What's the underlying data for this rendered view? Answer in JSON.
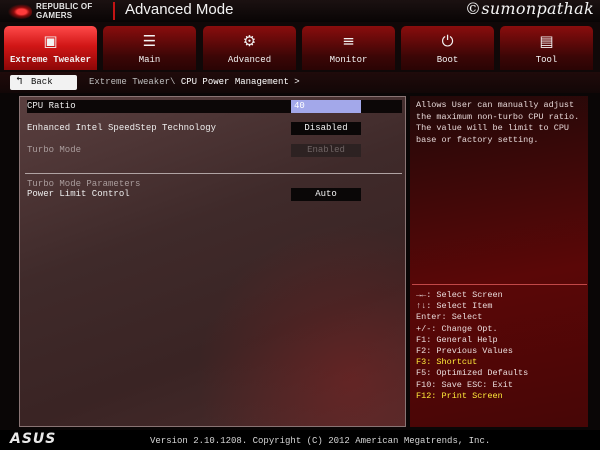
{
  "header": {
    "logo_line1": "REPUBLIC OF",
    "logo_line2": "GAMERS",
    "title": "Advanced Mode",
    "watermark": "©sumonpathak"
  },
  "tabs": [
    {
      "label": "Extreme Tweaker",
      "icon": "cpu-chip-icon",
      "glyph": "▣",
      "active": true
    },
    {
      "label": "Main",
      "icon": "list-icon",
      "glyph": "☰",
      "active": false
    },
    {
      "label": "Advanced",
      "icon": "advanced-settings-icon",
      "glyph": "⚙",
      "active": false
    },
    {
      "label": "Monitor",
      "icon": "monitor-icon",
      "glyph": "≡",
      "active": false
    },
    {
      "label": "Boot",
      "icon": "power-icon",
      "glyph": "⏻",
      "active": false
    },
    {
      "label": "Tool",
      "icon": "toolbox-icon",
      "glyph": "▤",
      "active": false
    }
  ],
  "breadcrumb": {
    "back_label": "Back",
    "path": "Extreme Tweaker\\ ",
    "current": "CPU Power Management >"
  },
  "settings": {
    "cpu_ratio": {
      "label": "CPU Ratio",
      "value": "40"
    },
    "speedstep": {
      "label": "Enhanced Intel SpeedStep Technology",
      "value": "Disabled"
    },
    "turbo_mode": {
      "label": "Turbo Mode",
      "value": "Enabled"
    },
    "turbo_params_header": "Turbo Mode Parameters",
    "power_limit": {
      "label": "Power Limit Control",
      "value": "Auto"
    }
  },
  "help": {
    "text": "Allows User can manually adjust the maximum non-turbo CPU ratio. The value will be limit to CPU base or factory setting.",
    "keys": [
      {
        "text": "→←: Select Screen",
        "highlight": false
      },
      {
        "text": "↑↓: Select Item",
        "highlight": false
      },
      {
        "text": "Enter: Select",
        "highlight": false
      },
      {
        "text": "+/-: Change Opt.",
        "highlight": false
      },
      {
        "text": "F1: General Help",
        "highlight": false
      },
      {
        "text": "F2: Previous Values",
        "highlight": false
      },
      {
        "text": "F3: Shortcut",
        "highlight": true
      },
      {
        "text": "F5: Optimized Defaults",
        "highlight": false
      },
      {
        "text": "F10: Save  ESC: Exit",
        "highlight": false
      },
      {
        "text": "F12: Print Screen",
        "highlight": true
      }
    ],
    "highlight_color": "#ffea3a"
  },
  "footer": {
    "brand": "ASUS",
    "version": "Version 2.10.1208. Copyright (C) 2012 American Megatrends, Inc."
  },
  "colors": {
    "accent": "#d11616",
    "selected_input": "#a3a8ea"
  }
}
